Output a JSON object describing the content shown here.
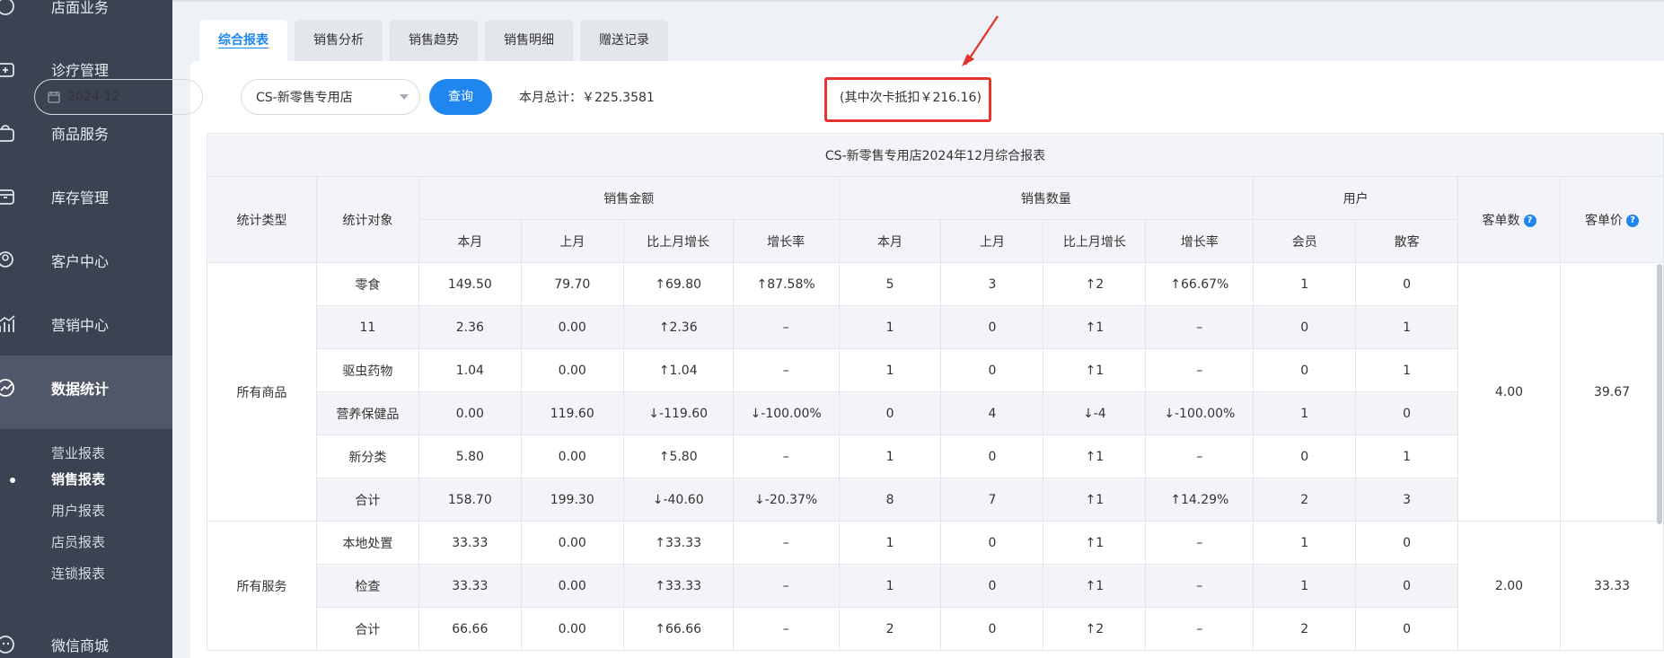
{
  "sidebar": {
    "items": [
      {
        "label": "店面业务",
        "icon": "store-icon"
      },
      {
        "label": "诊疗管理",
        "icon": "medical-kit-icon"
      },
      {
        "label": "商品服务",
        "icon": "bag-icon"
      },
      {
        "label": "库存管理",
        "icon": "box-icon"
      },
      {
        "label": "客户中心",
        "icon": "user-icon"
      },
      {
        "label": "营销中心",
        "icon": "chart-up-icon"
      },
      {
        "label": "数据统计",
        "icon": "trend-icon"
      },
      {
        "label": "微信商城",
        "icon": "wechat-icon"
      }
    ],
    "sub_items": [
      {
        "label": "营业报表"
      },
      {
        "label": "销售报表"
      },
      {
        "label": "用户报表"
      },
      {
        "label": "店员报表"
      },
      {
        "label": "连锁报表"
      }
    ]
  },
  "tabs": [
    "综合报表",
    "销售分析",
    "销售趋势",
    "销售明细",
    "赠送记录"
  ],
  "filters": {
    "date": "2024-12",
    "store": "CS-新零售专用店",
    "query_button": "查询"
  },
  "summary": {
    "total": "本月总计：￥225.3581",
    "card_deduct": "(其中次卡抵扣￥216.16)"
  },
  "table": {
    "title": "CS-新零售专用店2024年12月综合报表",
    "headers": {
      "type": "统计类型",
      "object": "统计对象",
      "sales_amount": "销售金额",
      "sales_qty": "销售数量",
      "users": "用户",
      "order_count": "客单数",
      "avg_price": "客单价",
      "this_month": "本月",
      "last_month": "上月",
      "mom_growth": "比上月增长",
      "growth_rate": "增长率",
      "member": "会员",
      "walk_in": "散客"
    },
    "groups": [
      {
        "type": "所有商品",
        "order_count": "4.00",
        "avg_price": "39.67",
        "rows": [
          {
            "object": "零食",
            "link": true,
            "amt_this": "149.50",
            "amt_last": "79.70",
            "amt_grow": "↑69.80",
            "amt_grow_dir": "up",
            "amt_rate": "↑87.58%",
            "amt_rate_dir": "up",
            "qty_this": "5",
            "qty_last": "3",
            "qty_grow": "↑2",
            "qty_grow_dir": "up",
            "qty_rate": "↑66.67%",
            "qty_rate_dir": "up",
            "member": "1",
            "walk_in": "0"
          },
          {
            "object": "11",
            "link": true,
            "amt_this": "2.36",
            "amt_last": "0.00",
            "amt_grow": "↑2.36",
            "amt_grow_dir": "up",
            "amt_rate": "–",
            "amt_rate_dir": "none",
            "qty_this": "1",
            "qty_last": "0",
            "qty_grow": "↑1",
            "qty_grow_dir": "up",
            "qty_rate": "–",
            "qty_rate_dir": "none",
            "member": "0",
            "walk_in": "1"
          },
          {
            "object": "驱虫药物",
            "link": true,
            "amt_this": "1.04",
            "amt_last": "0.00",
            "amt_grow": "↑1.04",
            "amt_grow_dir": "up",
            "amt_rate": "–",
            "amt_rate_dir": "none",
            "qty_this": "1",
            "qty_last": "0",
            "qty_grow": "↑1",
            "qty_grow_dir": "up",
            "qty_rate": "–",
            "qty_rate_dir": "none",
            "member": "0",
            "walk_in": "1"
          },
          {
            "object": "营养保健品",
            "link": true,
            "amt_this": "0.00",
            "amt_last": "119.60",
            "amt_grow": "↓-119.60",
            "amt_grow_dir": "down",
            "amt_rate": "↓-100.00%",
            "amt_rate_dir": "down",
            "qty_this": "0",
            "qty_last": "4",
            "qty_grow": "↓-4",
            "qty_grow_dir": "down",
            "qty_rate": "↓-100.00%",
            "qty_rate_dir": "down",
            "member": "1",
            "walk_in": "0"
          },
          {
            "object": "新分类",
            "link": true,
            "amt_this": "5.80",
            "amt_last": "0.00",
            "amt_grow": "↑5.80",
            "amt_grow_dir": "up",
            "amt_rate": "–",
            "amt_rate_dir": "none",
            "qty_this": "1",
            "qty_last": "0",
            "qty_grow": "↑1",
            "qty_grow_dir": "up",
            "qty_rate": "–",
            "qty_rate_dir": "none",
            "member": "0",
            "walk_in": "1"
          },
          {
            "object": "合计",
            "link": false,
            "amt_this": "158.70",
            "amt_last": "199.30",
            "amt_grow": "↓-40.60",
            "amt_grow_dir": "down",
            "amt_rate": "↓-20.37%",
            "amt_rate_dir": "down",
            "qty_this": "8",
            "qty_last": "7",
            "qty_grow": "↑1",
            "qty_grow_dir": "up",
            "qty_rate": "↑14.29%",
            "qty_rate_dir": "up",
            "member": "2",
            "walk_in": "3"
          }
        ]
      },
      {
        "type": "所有服务",
        "order_count": "2.00",
        "avg_price": "33.33",
        "rows": [
          {
            "object": "本地处置",
            "link": false,
            "amt_this": "33.33",
            "amt_last": "0.00",
            "amt_grow": "↑33.33",
            "amt_grow_dir": "up",
            "amt_rate": "–",
            "amt_rate_dir": "none",
            "qty_this": "1",
            "qty_last": "0",
            "qty_grow": "↑1",
            "qty_grow_dir": "up",
            "qty_rate": "–",
            "qty_rate_dir": "none",
            "member": "1",
            "walk_in": "0"
          },
          {
            "object": "检查",
            "link": false,
            "amt_this": "33.33",
            "amt_last": "0.00",
            "amt_grow": "↑33.33",
            "amt_grow_dir": "up",
            "amt_rate": "–",
            "amt_rate_dir": "none",
            "qty_this": "1",
            "qty_last": "0",
            "qty_grow": "↑1",
            "qty_grow_dir": "up",
            "qty_rate": "–",
            "qty_rate_dir": "none",
            "member": "1",
            "walk_in": "0"
          },
          {
            "object": "合计",
            "link": false,
            "amt_this": "66.66",
            "amt_last": "0.00",
            "amt_grow": "↑66.66",
            "amt_grow_dir": "up",
            "amt_rate": "–",
            "amt_rate_dir": "none",
            "qty_this": "2",
            "qty_last": "0",
            "qty_grow": "↑2",
            "qty_grow_dir": "up",
            "qty_rate": "–",
            "qty_rate_dir": "none",
            "member": "2",
            "walk_in": "0"
          }
        ]
      }
    ]
  },
  "colors": {
    "sidebar_bg": "#3b4352",
    "accent": "#1f86f0",
    "up": "#4bb84b",
    "down": "#e8504f",
    "highlight": "#e6322d"
  }
}
